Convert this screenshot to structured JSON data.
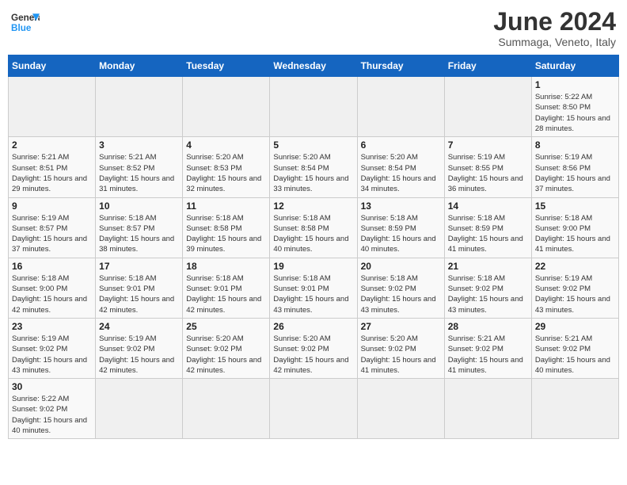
{
  "header": {
    "logo_general": "General",
    "logo_blue": "Blue",
    "month": "June 2024",
    "location": "Summaga, Veneto, Italy"
  },
  "weekdays": [
    "Sunday",
    "Monday",
    "Tuesday",
    "Wednesday",
    "Thursday",
    "Friday",
    "Saturday"
  ],
  "days": [
    {
      "date": "",
      "info": ""
    },
    {
      "date": "",
      "info": ""
    },
    {
      "date": "",
      "info": ""
    },
    {
      "date": "",
      "info": ""
    },
    {
      "date": "",
      "info": ""
    },
    {
      "date": "",
      "info": ""
    },
    {
      "date": "1",
      "info": "Sunrise: 5:22 AM\nSunset: 8:50 PM\nDaylight: 15 hours and 28 minutes."
    },
    {
      "date": "2",
      "info": "Sunrise: 5:21 AM\nSunset: 8:51 PM\nDaylight: 15 hours and 29 minutes."
    },
    {
      "date": "3",
      "info": "Sunrise: 5:21 AM\nSunset: 8:52 PM\nDaylight: 15 hours and 31 minutes."
    },
    {
      "date": "4",
      "info": "Sunrise: 5:20 AM\nSunset: 8:53 PM\nDaylight: 15 hours and 32 minutes."
    },
    {
      "date": "5",
      "info": "Sunrise: 5:20 AM\nSunset: 8:54 PM\nDaylight: 15 hours and 33 minutes."
    },
    {
      "date": "6",
      "info": "Sunrise: 5:20 AM\nSunset: 8:54 PM\nDaylight: 15 hours and 34 minutes."
    },
    {
      "date": "7",
      "info": "Sunrise: 5:19 AM\nSunset: 8:55 PM\nDaylight: 15 hours and 36 minutes."
    },
    {
      "date": "8",
      "info": "Sunrise: 5:19 AM\nSunset: 8:56 PM\nDaylight: 15 hours and 37 minutes."
    },
    {
      "date": "9",
      "info": "Sunrise: 5:19 AM\nSunset: 8:57 PM\nDaylight: 15 hours and 37 minutes."
    },
    {
      "date": "10",
      "info": "Sunrise: 5:18 AM\nSunset: 8:57 PM\nDaylight: 15 hours and 38 minutes."
    },
    {
      "date": "11",
      "info": "Sunrise: 5:18 AM\nSunset: 8:58 PM\nDaylight: 15 hours and 39 minutes."
    },
    {
      "date": "12",
      "info": "Sunrise: 5:18 AM\nSunset: 8:58 PM\nDaylight: 15 hours and 40 minutes."
    },
    {
      "date": "13",
      "info": "Sunrise: 5:18 AM\nSunset: 8:59 PM\nDaylight: 15 hours and 40 minutes."
    },
    {
      "date": "14",
      "info": "Sunrise: 5:18 AM\nSunset: 8:59 PM\nDaylight: 15 hours and 41 minutes."
    },
    {
      "date": "15",
      "info": "Sunrise: 5:18 AM\nSunset: 9:00 PM\nDaylight: 15 hours and 41 minutes."
    },
    {
      "date": "16",
      "info": "Sunrise: 5:18 AM\nSunset: 9:00 PM\nDaylight: 15 hours and 42 minutes."
    },
    {
      "date": "17",
      "info": "Sunrise: 5:18 AM\nSunset: 9:01 PM\nDaylight: 15 hours and 42 minutes."
    },
    {
      "date": "18",
      "info": "Sunrise: 5:18 AM\nSunset: 9:01 PM\nDaylight: 15 hours and 42 minutes."
    },
    {
      "date": "19",
      "info": "Sunrise: 5:18 AM\nSunset: 9:01 PM\nDaylight: 15 hours and 43 minutes."
    },
    {
      "date": "20",
      "info": "Sunrise: 5:18 AM\nSunset: 9:02 PM\nDaylight: 15 hours and 43 minutes."
    },
    {
      "date": "21",
      "info": "Sunrise: 5:18 AM\nSunset: 9:02 PM\nDaylight: 15 hours and 43 minutes."
    },
    {
      "date": "22",
      "info": "Sunrise: 5:19 AM\nSunset: 9:02 PM\nDaylight: 15 hours and 43 minutes."
    },
    {
      "date": "23",
      "info": "Sunrise: 5:19 AM\nSunset: 9:02 PM\nDaylight: 15 hours and 43 minutes."
    },
    {
      "date": "24",
      "info": "Sunrise: 5:19 AM\nSunset: 9:02 PM\nDaylight: 15 hours and 42 minutes."
    },
    {
      "date": "25",
      "info": "Sunrise: 5:20 AM\nSunset: 9:02 PM\nDaylight: 15 hours and 42 minutes."
    },
    {
      "date": "26",
      "info": "Sunrise: 5:20 AM\nSunset: 9:02 PM\nDaylight: 15 hours and 42 minutes."
    },
    {
      "date": "27",
      "info": "Sunrise: 5:20 AM\nSunset: 9:02 PM\nDaylight: 15 hours and 41 minutes."
    },
    {
      "date": "28",
      "info": "Sunrise: 5:21 AM\nSunset: 9:02 PM\nDaylight: 15 hours and 41 minutes."
    },
    {
      "date": "29",
      "info": "Sunrise: 5:21 AM\nSunset: 9:02 PM\nDaylight: 15 hours and 40 minutes."
    },
    {
      "date": "30",
      "info": "Sunrise: 5:22 AM\nSunset: 9:02 PM\nDaylight: 15 hours and 40 minutes."
    },
    {
      "date": "",
      "info": ""
    },
    {
      "date": "",
      "info": ""
    },
    {
      "date": "",
      "info": ""
    },
    {
      "date": "",
      "info": ""
    },
    {
      "date": "",
      "info": ""
    },
    {
      "date": "",
      "info": ""
    }
  ]
}
